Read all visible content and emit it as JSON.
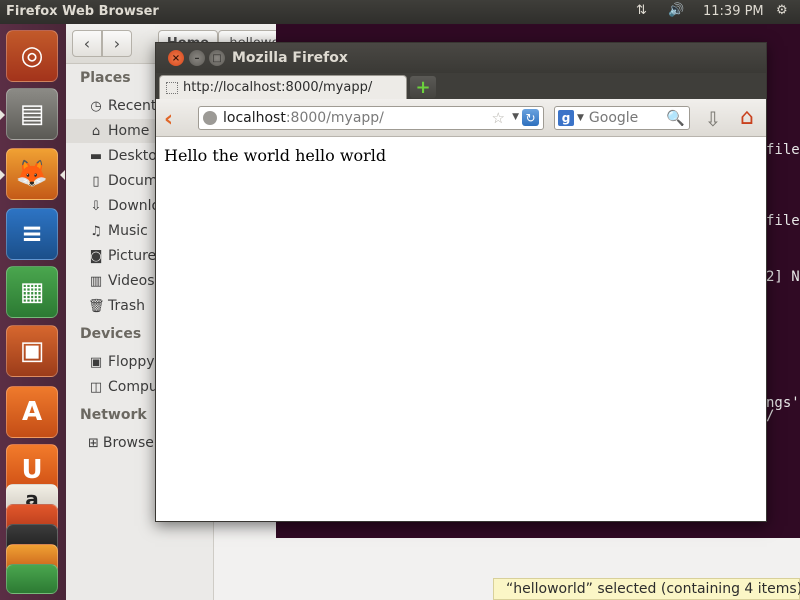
{
  "top_panel": {
    "title": "Firefox Web Browser",
    "network_icon": "⇅",
    "volume_icon": "🔊",
    "clock": "11:39 PM",
    "gear_icon": "⚙"
  },
  "launcher": {
    "items": [
      {
        "name": "dash-home",
        "glyph": "◎"
      },
      {
        "name": "files",
        "glyph": "▤"
      },
      {
        "name": "firefox",
        "glyph": "🦊"
      },
      {
        "name": "libreoffice-writer",
        "glyph": "≡"
      },
      {
        "name": "libreoffice-calc",
        "glyph": "▦"
      },
      {
        "name": "libreoffice-impress",
        "glyph": "▣"
      },
      {
        "name": "ubuntu-software-center",
        "glyph": "A"
      },
      {
        "name": "ubuntu-one",
        "glyph": "U"
      },
      {
        "name": "amazon",
        "glyph": "a"
      }
    ]
  },
  "nautilus": {
    "home_crumb": "Home",
    "folder_crumb": "helloworld",
    "sidebar": {
      "places_heading": "Places",
      "places": [
        {
          "label": "Recent",
          "icon": "◷"
        },
        {
          "label": "Home",
          "icon": "⌂"
        },
        {
          "label": "Desktop",
          "icon": "▬"
        },
        {
          "label": "Documents",
          "icon": "▯"
        },
        {
          "label": "Downloads",
          "icon": "⇩"
        },
        {
          "label": "Music",
          "icon": "♫"
        },
        {
          "label": "Pictures",
          "icon": "◙"
        },
        {
          "label": "Videos",
          "icon": "▥"
        },
        {
          "label": "Trash",
          "icon": "🗑"
        }
      ],
      "devices_heading": "Devices",
      "devices": [
        {
          "label": "Floppy Disk",
          "icon": "▣"
        },
        {
          "label": "Computer",
          "icon": "◫"
        }
      ],
      "network_heading": "Network",
      "network": [
        {
          "label": "Browse Network",
          "icon": "⊞"
        }
      ]
    },
    "status": "“helloworld” selected  (containing 4 items)"
  },
  "terminal": {
    "lines": [
      "file",
      "file",
      "2] Ne",
      "ngs'",
      "/"
    ]
  },
  "firefox": {
    "window_title": "Mozilla Firefox",
    "tab_label": "http://localhost:8000/myapp/",
    "url_host": "localhost",
    "url_path": ":8000/myapp/",
    "search_placeholder": "Google",
    "search_engine_icon": "g",
    "page_text": "Hello the world hello world"
  }
}
